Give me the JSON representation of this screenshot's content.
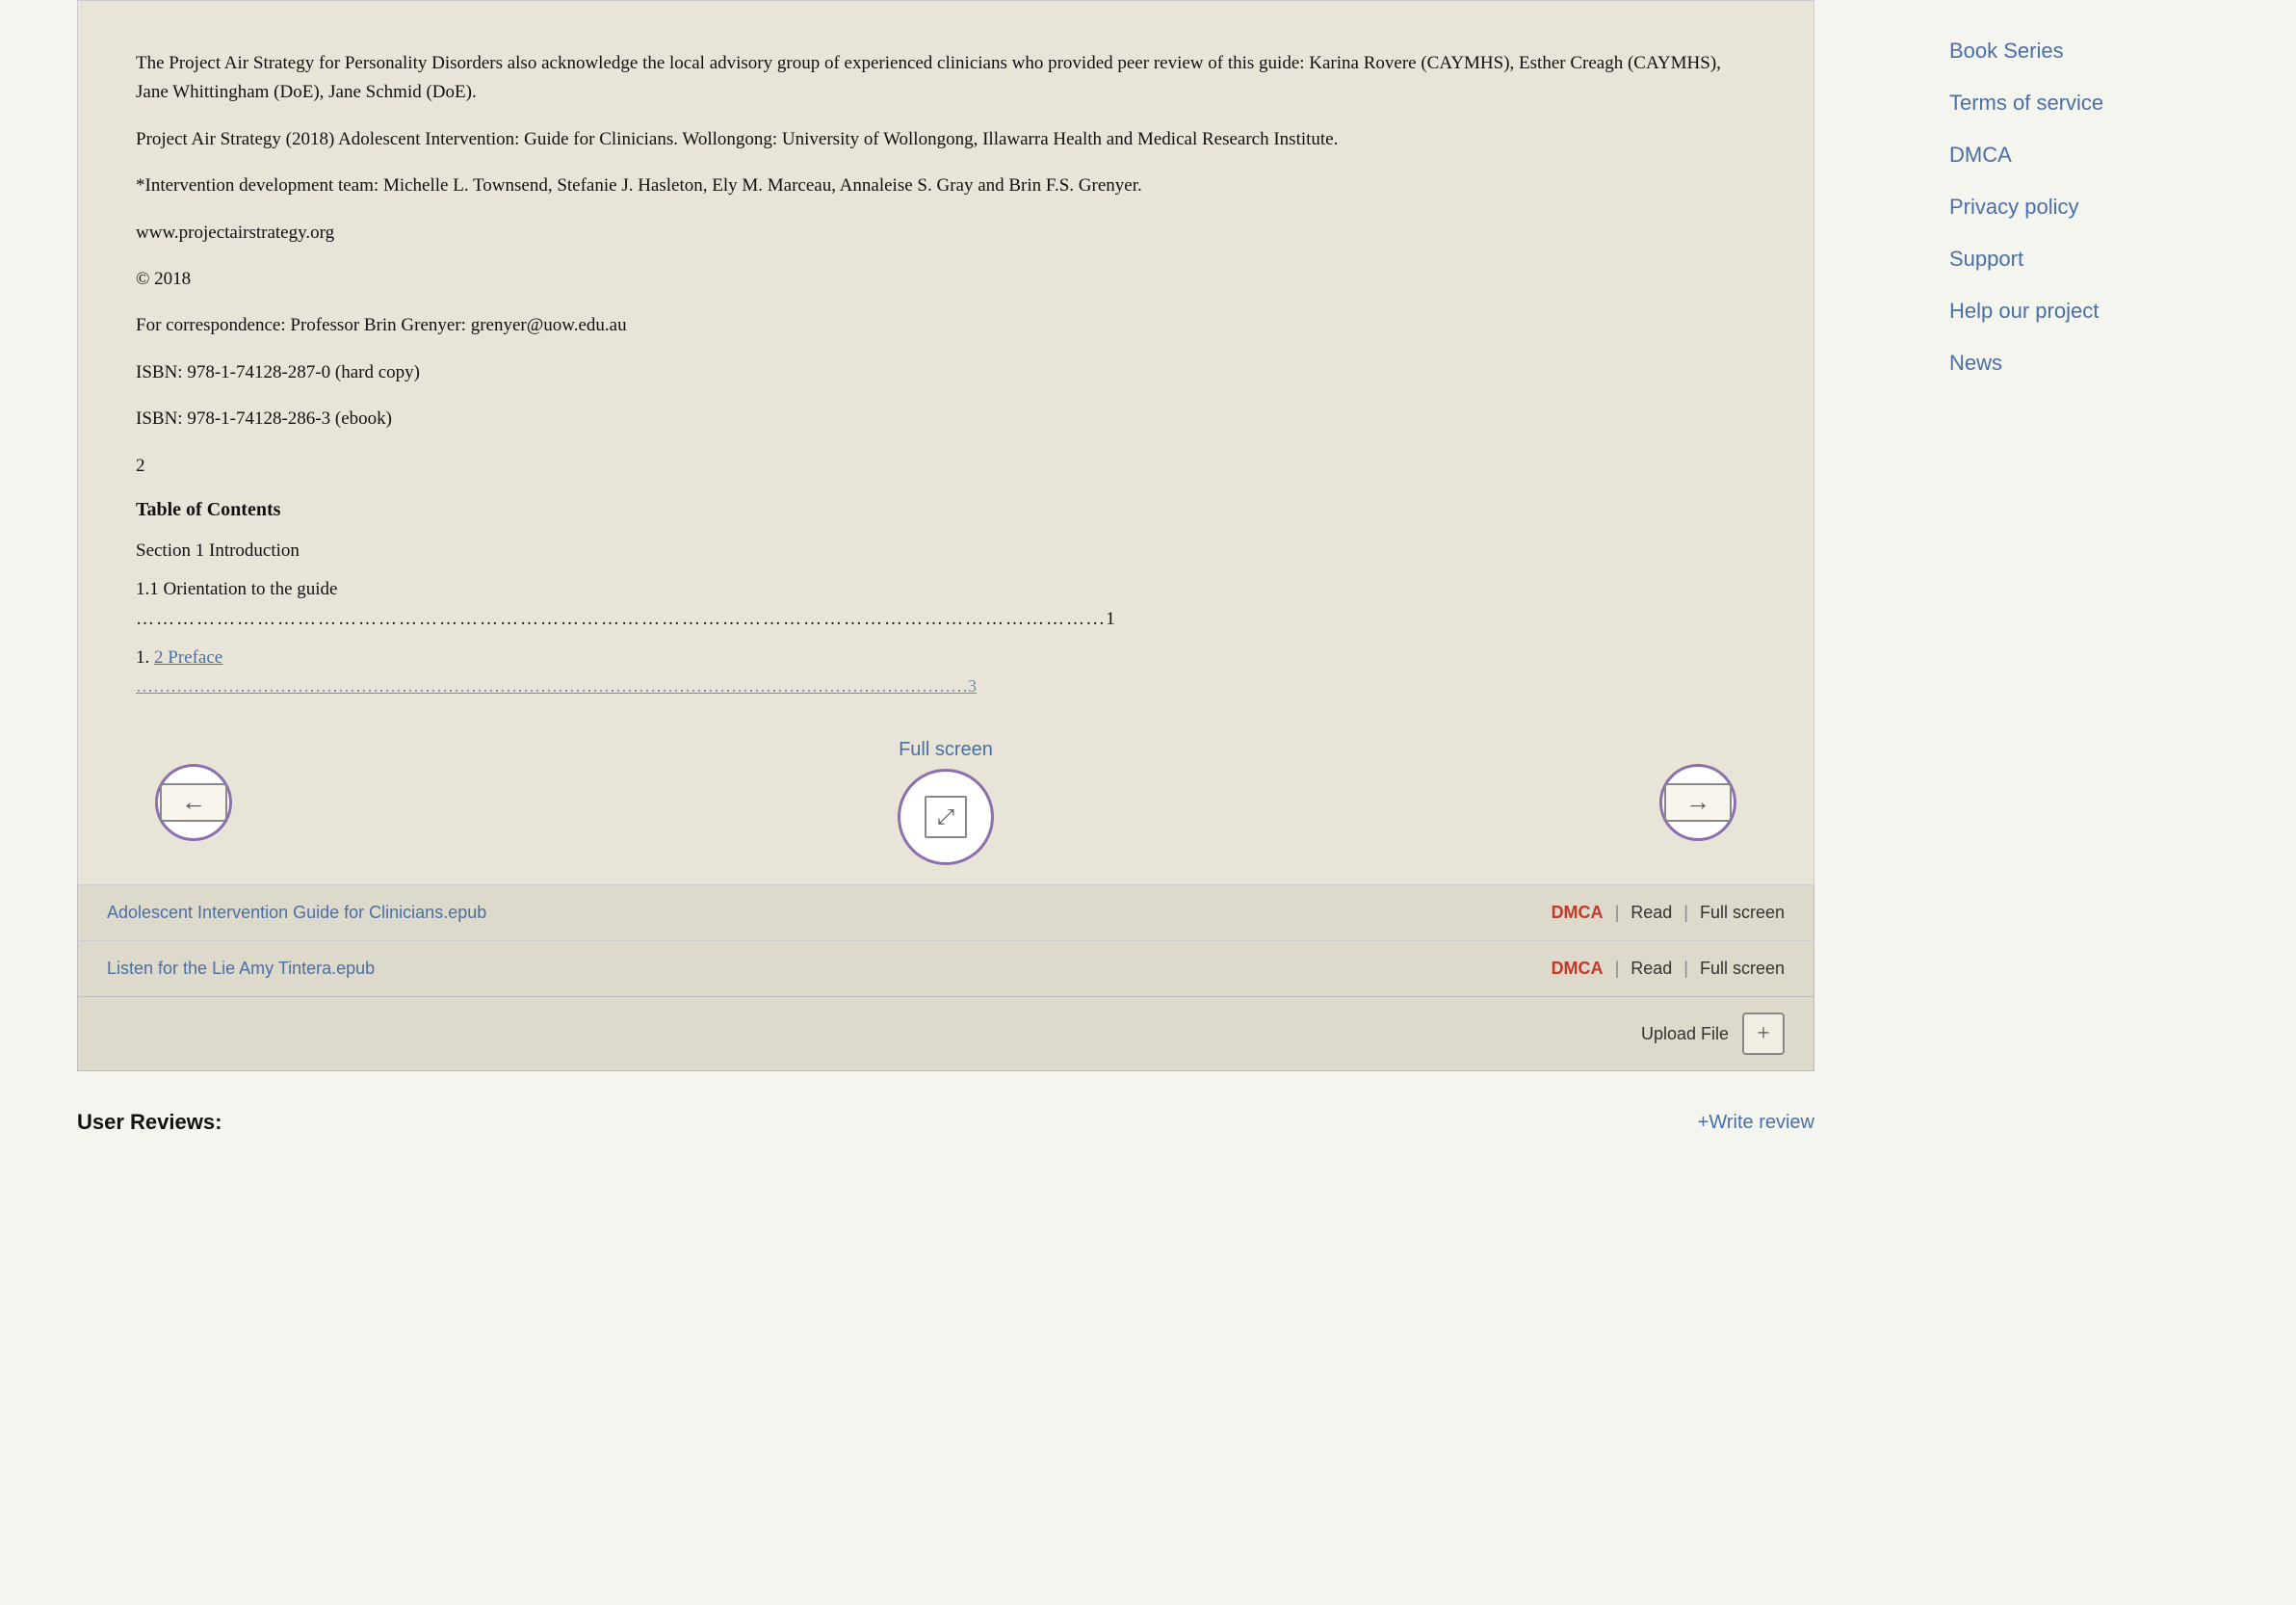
{
  "sidebar": {
    "links": [
      {
        "id": "book-series",
        "label": "Book Series"
      },
      {
        "id": "terms-of-service",
        "label": "Terms of service"
      },
      {
        "id": "dmca",
        "label": "DMCA"
      },
      {
        "id": "privacy-policy",
        "label": "Privacy policy"
      },
      {
        "id": "support",
        "label": "Support"
      },
      {
        "id": "help-our-project",
        "label": "Help our project"
      },
      {
        "id": "news",
        "label": "News"
      }
    ]
  },
  "book": {
    "paragraphs": [
      "The Project Air Strategy for Personality Disorders also acknowledge the local advisory group of experienced clinicians who provided peer review of this guide: Karina Rovere (CAYMHS), Esther Creagh (CAYMHS), Jane Whittingham (DoE), Jane Schmid (DoE).",
      "Project Air Strategy (2018) Adolescent Intervention: Guide for Clinicians. Wollongong: University of Wollongong, Illawarra Health and Medical Research Institute.",
      "*Intervention development team: Michelle L. Townsend, Stefanie J. Hasleton, Ely M. Marceau, Annaleise S. Gray and Brin F.S. Grenyer.",
      "www.projectairstrategy.org",
      "© 2018",
      "For correspondence: Professor Brin Grenyer: grenyer@uow.edu.au",
      "ISBN: 978-1-74128-287-0 (hard copy)",
      "ISBN: 978-1-74128-286-3 (ebook)",
      "2"
    ],
    "toc_heading": "Table of Contents",
    "toc_items": [
      {
        "text": "Section 1 Introduction",
        "type": "section"
      },
      {
        "text": "1.1 Orientation to the guide",
        "dots": "……………………………………………………………………………………………………………………………...1",
        "type": "item"
      },
      {
        "text": "1.",
        "link_text": "2 Preface",
        "dots_link": "………………………………………………………………………………………………………………………………3",
        "type": "link-item"
      }
    ]
  },
  "controls": {
    "fullscreen_label": "Full screen",
    "prev_title": "Previous page",
    "next_title": "Next page"
  },
  "files": [
    {
      "name": "Adolescent Intervention Guide for Clinicians.epub",
      "actions": [
        "DMCA",
        "Read",
        "Full screen"
      ]
    },
    {
      "name": "Listen for the Lie Amy Tintera.epub",
      "actions": [
        "DMCA",
        "Read",
        "Full screen"
      ]
    }
  ],
  "upload": {
    "label": "Upload File",
    "plus": "+"
  },
  "reviews": {
    "label": "User Reviews:",
    "write_link": "+Write review"
  }
}
